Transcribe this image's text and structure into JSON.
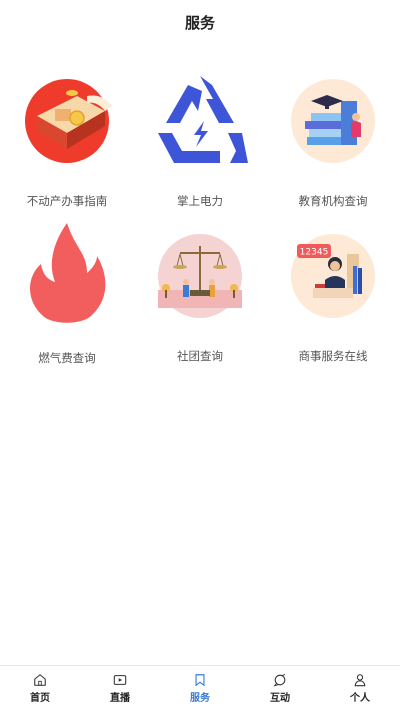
{
  "header": {
    "title": "服务"
  },
  "services": [
    {
      "label": "不动产办事指南",
      "icon": "property-guide-icon"
    },
    {
      "label": "掌上电力",
      "icon": "power-recycle-icon"
    },
    {
      "label": "教育机构查询",
      "icon": "education-books-icon"
    },
    {
      "label": "燃气费查询",
      "icon": "flame-icon"
    },
    {
      "label": "社团查询",
      "icon": "justice-scale-icon"
    },
    {
      "label": "商事服务在线",
      "icon": "hotline-12345-icon",
      "badge": "12345"
    }
  ],
  "tabs": [
    {
      "label": "首页",
      "icon": "home-icon"
    },
    {
      "label": "直播",
      "icon": "tv-play-icon"
    },
    {
      "label": "服务",
      "icon": "bookmark-icon",
      "active": true
    },
    {
      "label": "互动",
      "icon": "chat-icon"
    },
    {
      "label": "个人",
      "icon": "person-icon"
    }
  ],
  "colors": {
    "accent": "#3a7bd5",
    "flame": "#f25d5d",
    "power": "#3f55d8"
  }
}
